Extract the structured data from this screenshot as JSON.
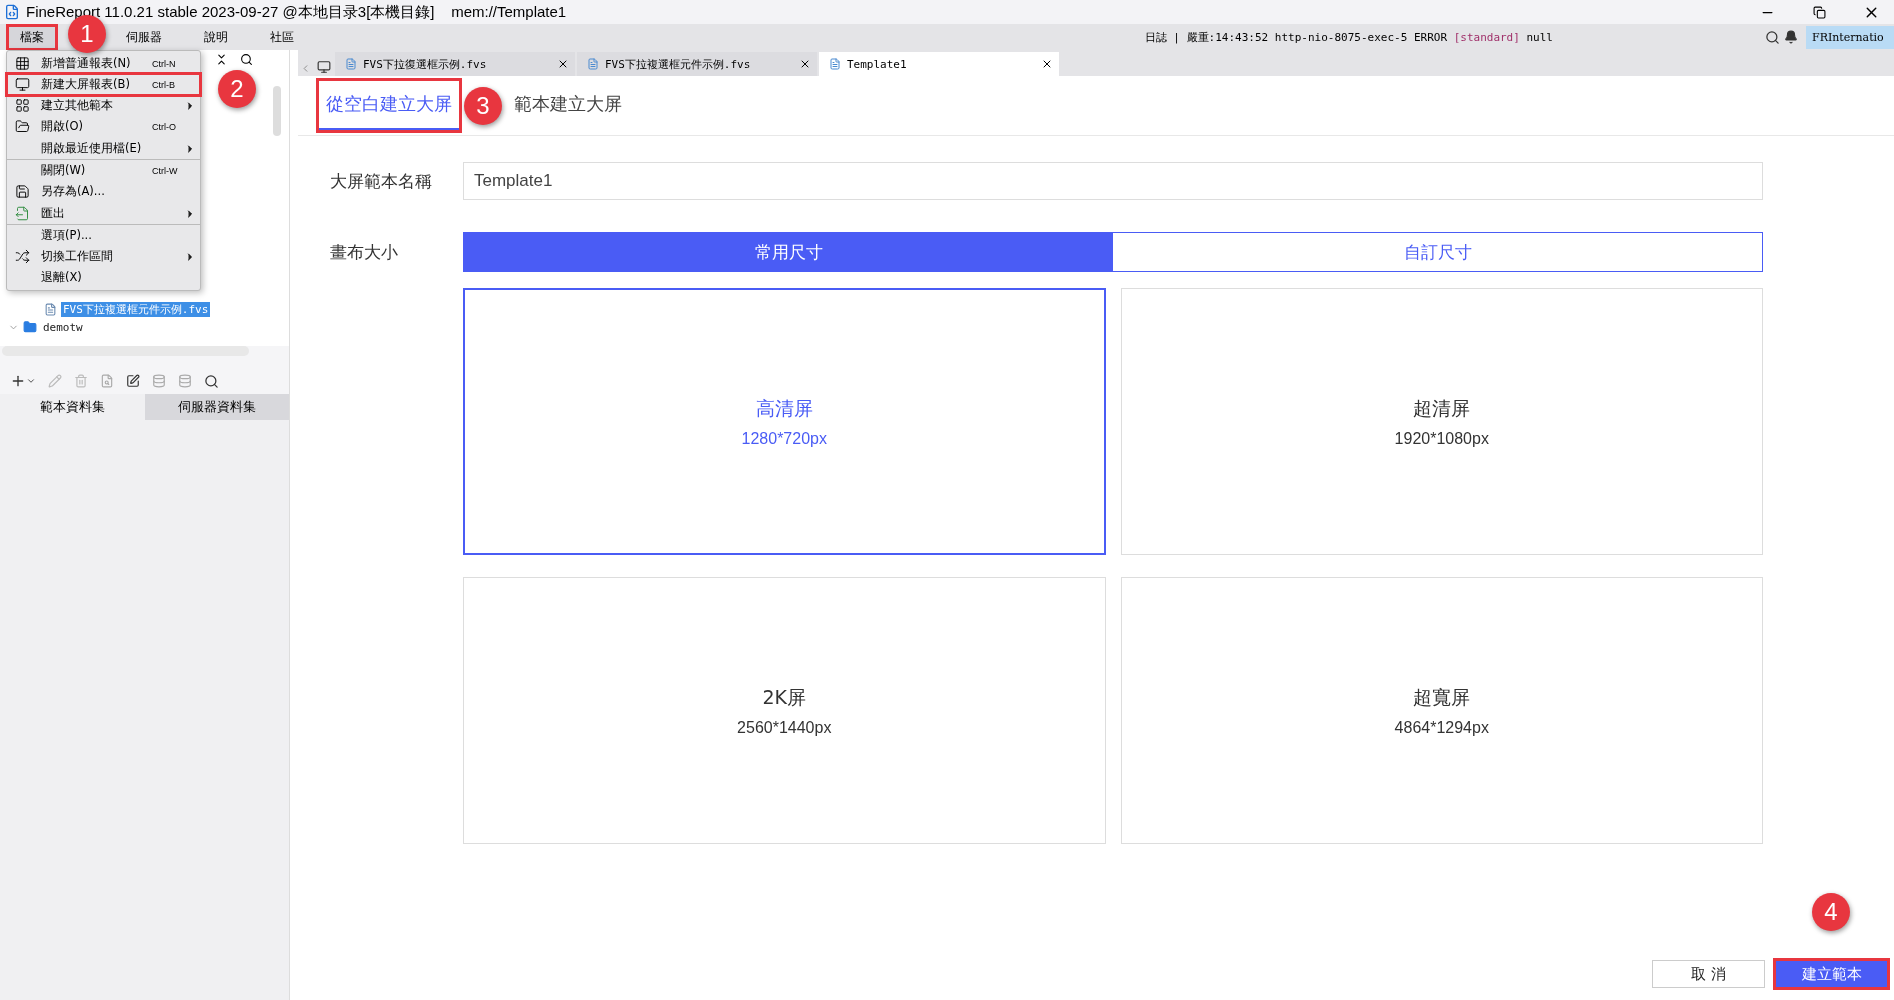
{
  "window": {
    "title": "FineReport 11.0.21 stable 2023-09-27 @本地目录3[本機目錄]    mem://Template1"
  },
  "menubar": [
    {
      "label": "檔案",
      "selected": true,
      "annotated": true
    },
    {
      "label": "伺服器",
      "selected": false,
      "annotated": false
    },
    {
      "label": "說明",
      "selected": false,
      "annotated": false
    },
    {
      "label": "社區",
      "selected": false,
      "annotated": false
    }
  ],
  "log": {
    "label": "日誌",
    "separator": "|",
    "level": "嚴重",
    "message": ":14:43:52 http-nio-8075-exec-5 ERROR [standard] null"
  },
  "user": "FRInternatio",
  "file_menu": [
    {
      "label": "新增普通報表(N)",
      "shortcut": "Ctrl-N",
      "submenu": false,
      "separator_after": false,
      "annotated": false
    },
    {
      "label": "新建大屏報表(B)",
      "shortcut": "Ctrl-B",
      "submenu": false,
      "separator_after": false,
      "annotated": true
    },
    {
      "label": "建立其他範本",
      "submenu": true,
      "separator_after": false,
      "annotated": false
    },
    {
      "label": "開啟(O)",
      "shortcut": "Ctrl-O",
      "submenu": false,
      "separator_after": false,
      "annotated": false
    },
    {
      "label": "開啟最近使用檔(E)",
      "submenu": true,
      "separator_after": true,
      "annotated": false
    },
    {
      "label": "關閉(W)",
      "shortcut": "Ctrl-W",
      "submenu": false,
      "separator_after": false,
      "annotated": false
    },
    {
      "label": "另存為(A)...",
      "submenu": false,
      "separator_after": false,
      "annotated": false
    },
    {
      "label": "匯出",
      "submenu": true,
      "separator_after": true,
      "annotated": false
    },
    {
      "label": "選項(P)...",
      "submenu": false,
      "separator_after": false,
      "annotated": false
    },
    {
      "label": "切換工作區間",
      "submenu": true,
      "separator_after": false,
      "annotated": false
    },
    {
      "label": "退離(X)",
      "submenu": false,
      "separator_after": false,
      "annotated": false
    }
  ],
  "tree": [
    {
      "kind": "file",
      "label": "FVS下拉複選框元件示例.fvs",
      "selected": true
    },
    {
      "kind": "folder",
      "label": "demotw",
      "selected": false
    }
  ],
  "dataset_tabs": [
    {
      "label": "範本資料集",
      "selected": true
    },
    {
      "label": "伺服器資料集",
      "selected": false
    }
  ],
  "doc_tabs": [
    {
      "label": "FVS下拉復選框示例.fvs",
      "selected": false
    },
    {
      "label": "FVS下拉複選框元件示例.fvs",
      "selected": false
    },
    {
      "label": "Template1",
      "selected": true
    }
  ],
  "mode_tabs": [
    {
      "label": "從空白建立大屏",
      "selected": true,
      "annotated": true
    },
    {
      "label": "範本建立大屏",
      "selected": false,
      "annotated": false
    }
  ],
  "name_field": {
    "label": "大屏範本名稱",
    "value": "Template1"
  },
  "canvas_size": {
    "label": "畫布大小",
    "options": [
      {
        "label": "常用尺寸",
        "selected": true
      },
      {
        "label": "自訂尺寸",
        "selected": false
      }
    ]
  },
  "presets": [
    {
      "title": "高清屏",
      "size": "1280*720px",
      "selected": true
    },
    {
      "title": "超清屏",
      "size": "1920*1080px",
      "selected": false
    },
    {
      "title": "2K屏",
      "size": "2560*1440px",
      "selected": false
    },
    {
      "title": "超寬屏",
      "size": "4864*1294px",
      "selected": false
    }
  ],
  "buttons": [
    {
      "kind": "secondary",
      "label": "取 消",
      "annotated": false
    },
    {
      "kind": "primary",
      "label": "建立範本",
      "annotated": true
    }
  ],
  "markers": [
    "1",
    "2",
    "3",
    "4"
  ]
}
